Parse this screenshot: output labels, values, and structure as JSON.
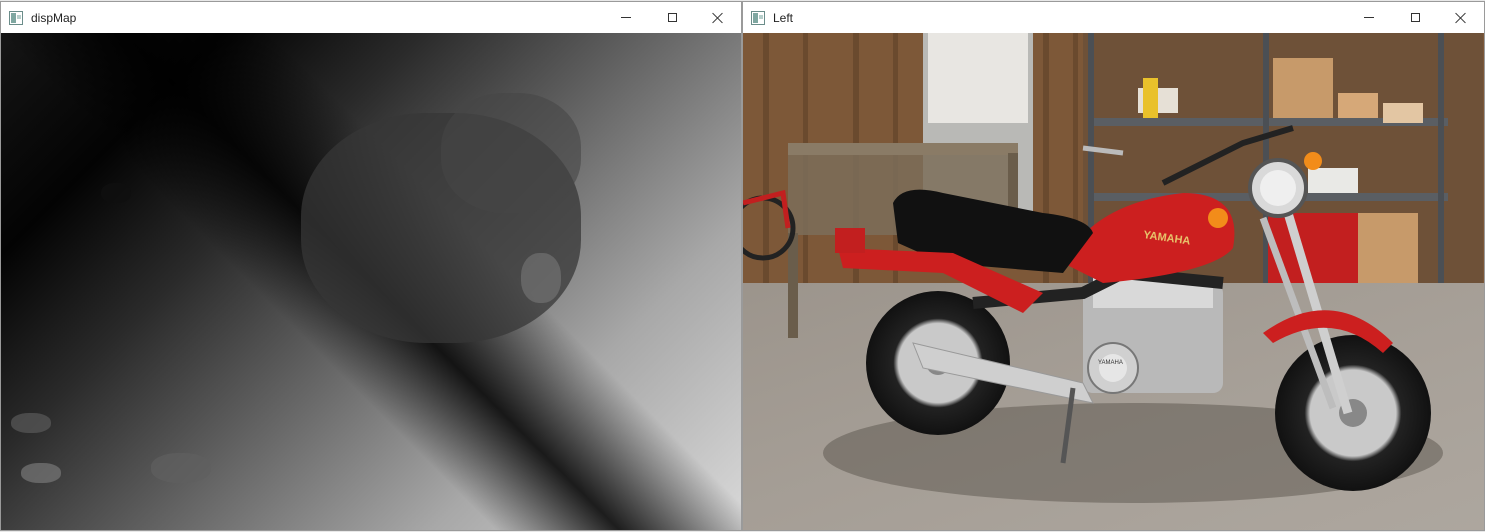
{
  "windows": [
    {
      "id": "dispMap",
      "title": "dispMap",
      "content": "disparity-map-image"
    },
    {
      "id": "left",
      "title": "Left",
      "content": "motorcycle-photo",
      "photo_text": {
        "tank_badge": "YAMAHA",
        "engine_badge": "YAMAHA"
      }
    }
  ],
  "window_controls": {
    "minimize_icon": "minimize-icon",
    "maximize_icon": "maximize-icon",
    "close_icon": "close-icon"
  },
  "colors": {
    "motorcycle_red": "#cc1f1f",
    "seat_black": "#111111",
    "floor_gray": "#a8a29b",
    "wall_wood": "#8a6446"
  }
}
